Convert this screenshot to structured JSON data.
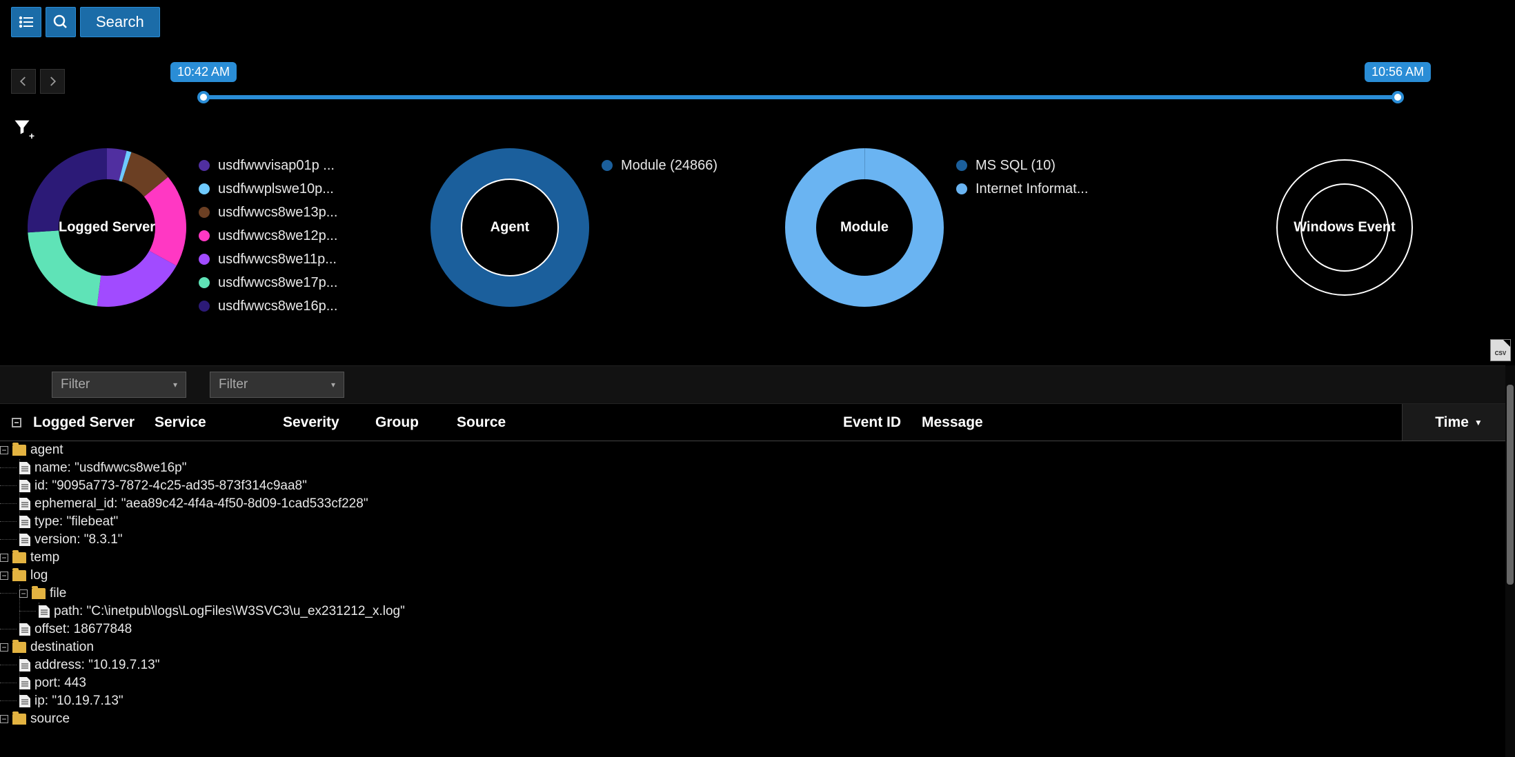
{
  "toolbar": {
    "search_label": "Search"
  },
  "time_slider": {
    "start_label": "10:42 AM",
    "end_label": "10:56 AM"
  },
  "chart_data": [
    {
      "type": "pie",
      "title": "Logged Server",
      "series": [
        {
          "name": "usdfwwvisap01p ...",
          "value": 4,
          "color": "#502fa0"
        },
        {
          "name": "usdfwwplswe10p...",
          "value": 1,
          "color": "#6ecaff"
        },
        {
          "name": "usdfwwcs8we13p...",
          "value": 9,
          "color": "#6b3f23"
        },
        {
          "name": "usdfwwcs8we12p...",
          "value": 19,
          "color": "#ff38c3"
        },
        {
          "name": "usdfwwcs8we11p...",
          "value": 19,
          "color": "#a14bff"
        },
        {
          "name": "usdfwwcs8we17p...",
          "value": 22,
          "color": "#5fe3b7"
        },
        {
          "name": "usdfwwcs8we16p...",
          "value": 26,
          "color": "#2c1a77"
        }
      ]
    },
    {
      "type": "pie",
      "title": "Agent",
      "series": [
        {
          "name": "Module (24866)",
          "value": 24866,
          "color": "#1b5f9c"
        }
      ]
    },
    {
      "type": "pie",
      "title": "Module",
      "series": [
        {
          "name": "MS SQL (10)",
          "value": 10,
          "color": "#1b5f9c"
        },
        {
          "name": "Internet Informat...",
          "value": 24856,
          "color": "#6ab4f2"
        }
      ]
    },
    {
      "type": "pie",
      "title": "Windows Event",
      "series": []
    }
  ],
  "filters": {
    "placeholder1": "Filter",
    "placeholder2": "Filter"
  },
  "columns": {
    "logged_server": "Logged Server",
    "service": "Service",
    "severity": "Severity",
    "group": "Group",
    "source": "Source",
    "event_id": "Event ID",
    "message": "Message",
    "time": "Time"
  },
  "tree": {
    "agent": {
      "label": "agent",
      "name": "name: \"usdfwwcs8we16p\"",
      "id": "id: \"9095a773-7872-4c25-ad35-873f314c9aa8\"",
      "ephemeral_id": "ephemeral_id: \"aea89c42-4f4a-4f50-8d09-1cad533cf228\"",
      "type": "type: \"filebeat\"",
      "version": "version: \"8.3.1\""
    },
    "temp": {
      "label": "temp"
    },
    "log": {
      "label": "log",
      "file": {
        "label": "file",
        "path": "path: \"C:\\inetpub\\logs\\LogFiles\\W3SVC3\\u_ex231212_x.log\""
      },
      "offset": "offset: 18677848"
    },
    "destination": {
      "label": "destination",
      "address": "address: \"10.19.7.13\"",
      "port": "port: 443",
      "ip": "ip: \"10.19.7.13\""
    },
    "source": {
      "label": "source"
    }
  }
}
